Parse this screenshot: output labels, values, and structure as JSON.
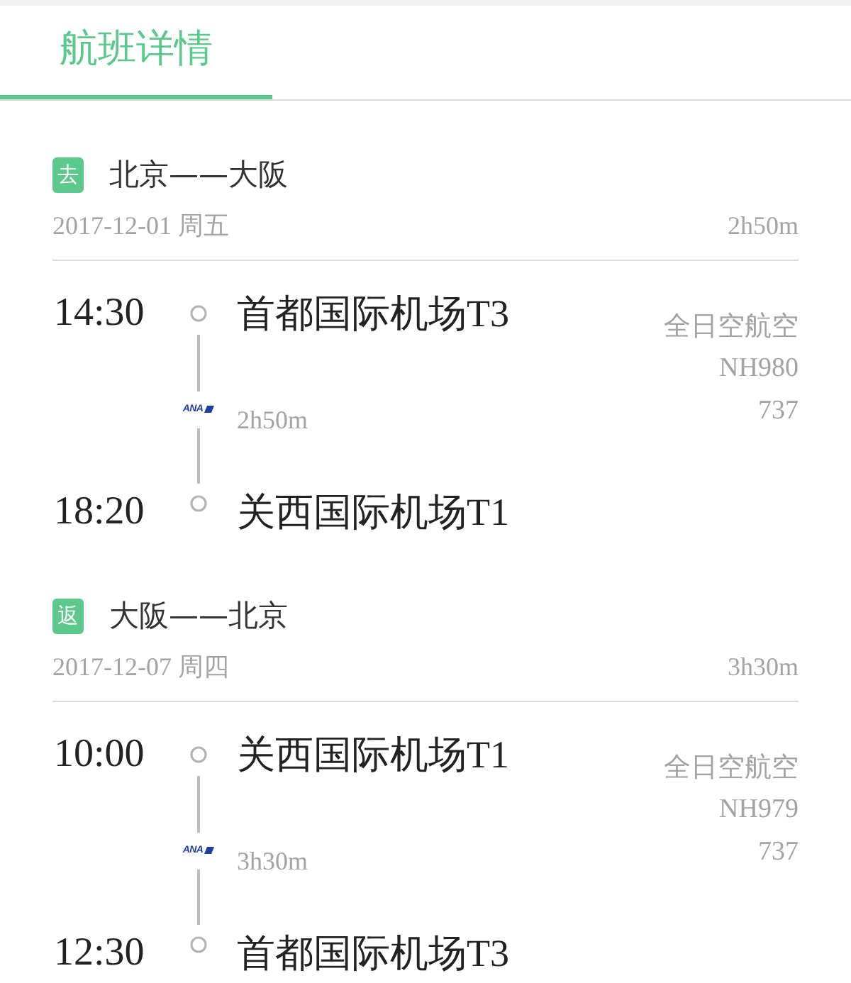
{
  "tabs": [
    {
      "label": "航班详情",
      "selected": true
    }
  ],
  "trips": [
    {
      "badge": "去",
      "route": "北京——大阪",
      "date": "2017-12-01 周五",
      "duration": "2h50m",
      "departure": {
        "time": "14:30",
        "airport": "首都国际机场T3"
      },
      "leg": {
        "logo_text": "ANA",
        "duration": "2h50m"
      },
      "arrival": {
        "time": "18:20",
        "airport": "关西国际机场T1"
      },
      "airline": "全日空航空",
      "flight_number": "NH980",
      "aircraft": "737"
    },
    {
      "badge": "返",
      "route": "大阪——北京",
      "date": "2017-12-07 周四",
      "duration": "3h30m",
      "departure": {
        "time": "10:00",
        "airport": "关西国际机场T1"
      },
      "leg": {
        "logo_text": "ANA",
        "duration": "3h30m"
      },
      "arrival": {
        "time": "12:30",
        "airport": "首都国际机场T3"
      },
      "airline": "全日空航空",
      "flight_number": "NH979",
      "aircraft": "737"
    }
  ]
}
